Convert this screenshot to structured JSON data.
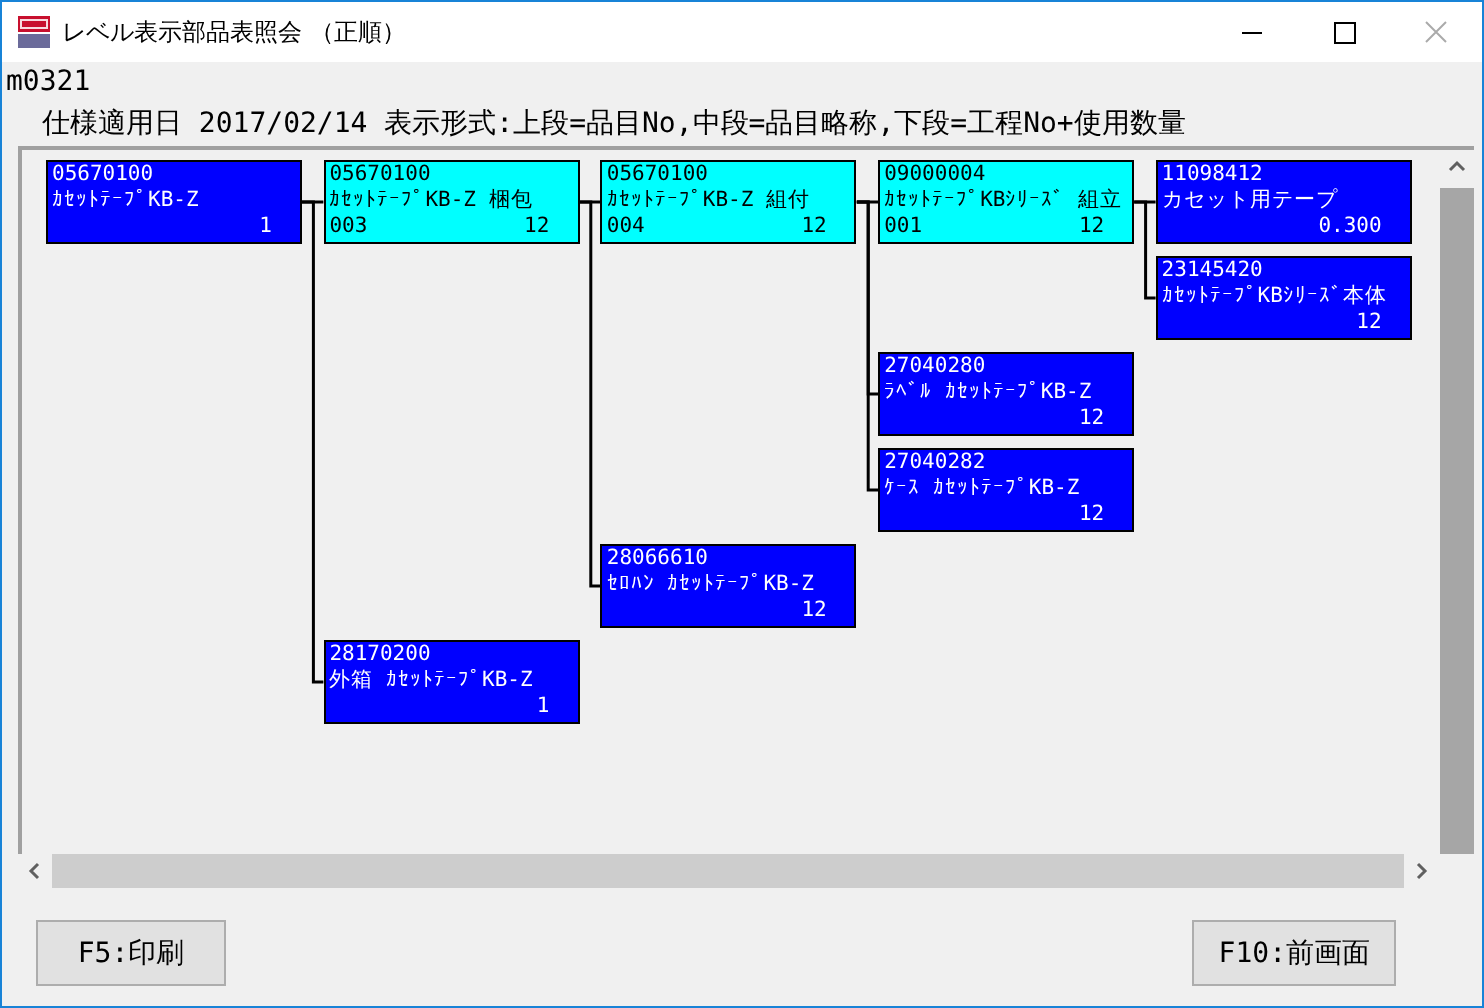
{
  "window": {
    "title": "レベル表示部品表照会 （正順）"
  },
  "form_id": "m0321",
  "header": "仕様適用日  2017/02/14 表示形式:上段=品目No,中段=品目略称,下段=工程No+使用数量",
  "tree": [
    {
      "item_no": "05670100",
      "name": "ｶｾｯﾄﾃｰﾌﾟKB-Z",
      "quantity": "1",
      "color": "#0000ff",
      "children": [
        {
          "item_no": "05670100",
          "name": "ｶｾｯﾄﾃｰﾌﾟKB-Z 梱包",
          "process_no": "003",
          "quantity": "12",
          "color": "#00ffff",
          "children": [
            {
              "item_no": "05670100",
              "name": "ｶｾｯﾄﾃｰﾌﾟKB-Z 組付",
              "process_no": "004",
              "quantity": "12",
              "color": "#00ffff",
              "children": [
                {
                  "item_no": "09000004",
                  "name": "ｶｾｯﾄﾃｰﾌﾟKBｼﾘｰｽﾞ 組立",
                  "process_no": "001",
                  "quantity": "12",
                  "color": "#00ffff",
                  "children": [
                    {
                      "item_no": "11098412",
                      "name": "カセット用テープ",
                      "quantity": "0.300",
                      "color": "#0000ff"
                    },
                    {
                      "item_no": "23145420",
                      "name": "ｶｾｯﾄﾃｰﾌﾟKBｼﾘｰｽﾞ本体",
                      "quantity": "12",
                      "color": "#0000ff"
                    }
                  ]
                },
                {
                  "item_no": "27040280",
                  "name": "ﾗﾍﾞﾙ ｶｾｯﾄﾃｰﾌﾟKB-Z",
                  "quantity": "12",
                  "color": "#0000ff"
                },
                {
                  "item_no": "27040282",
                  "name": "ｹｰｽ ｶｾｯﾄﾃｰﾌﾟKB-Z",
                  "quantity": "12",
                  "color": "#0000ff"
                }
              ]
            },
            {
              "item_no": "28066610",
              "name": "ｾﾛﾊﾝ ｶｾｯﾄﾃｰﾌﾟKB-Z",
              "quantity": "12",
              "color": "#0000ff"
            }
          ]
        },
        {
          "item_no": "28170200",
          "name": "外箱 ｶｾｯﾄﾃｰﾌﾟKB-Z",
          "quantity": "1",
          "color": "#0000ff"
        }
      ]
    }
  ],
  "buttons": [
    {
      "label": "F5:印刷"
    },
    {
      "label": "F10:前画面"
    }
  ]
}
